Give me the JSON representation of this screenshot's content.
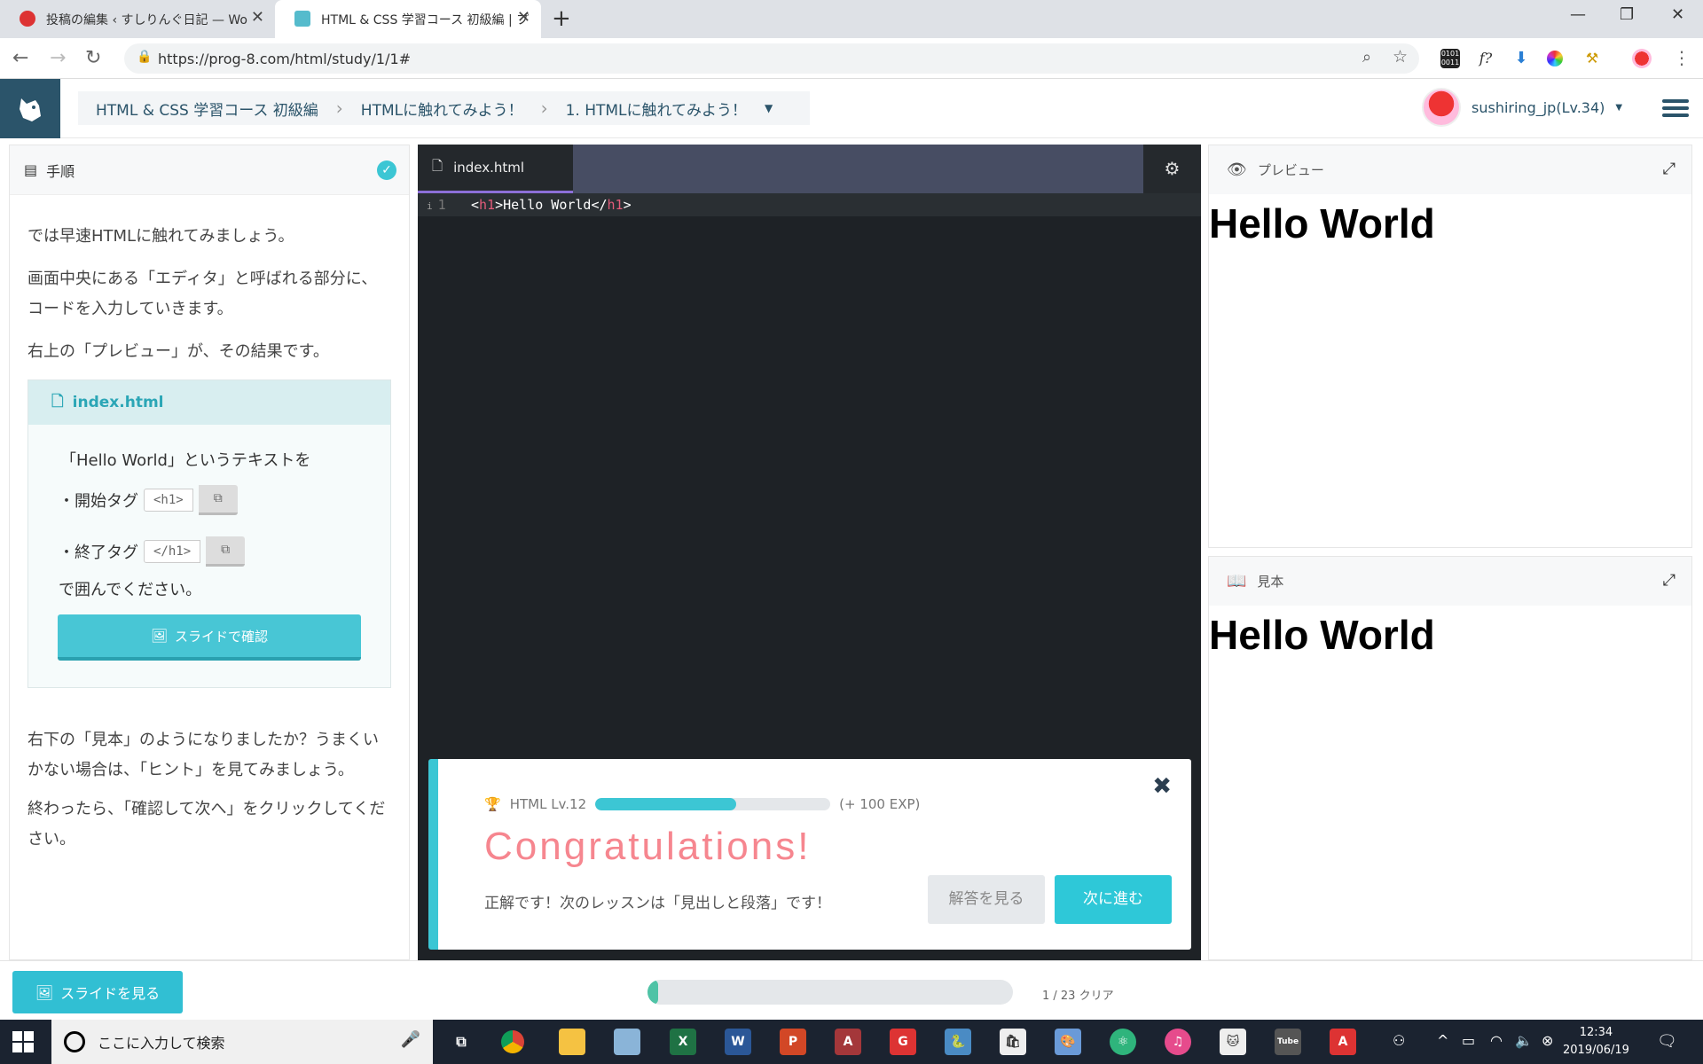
{
  "browser": {
    "tabs": [
      {
        "label": "投稿の編集 ‹ すしりんぐ日記 — Wo"
      },
      {
        "label": "HTML & CSS 学習コース 初級編 | プ"
      }
    ],
    "new_tab_glyph": "+",
    "url": "https://prog-8.com/html/study/1/1#",
    "window_controls": {
      "minimize": "—",
      "restore": "❐",
      "close": "✕"
    }
  },
  "app": {
    "breadcrumbs": [
      "HTML & CSS 学習コース 初級編",
      "HTMLに触れてみよう！",
      "1. HTMLに触れてみよう！"
    ],
    "username": "sushiring_jp(Lv.34)"
  },
  "instructions": {
    "header": "手順",
    "paragraphs": [
      "では早速HTMLに触れてみましょう。",
      "画面中央にある「エディタ」と呼ばれる部分に、コードを入力していきます。",
      "右上の「プレビュー」が、その結果です。"
    ],
    "box": {
      "filename": "index.html",
      "line1": "「Hello World」というテキストを",
      "start_label": "・開始タグ",
      "start_tag": "<h1>",
      "end_label": "・終了タグ",
      "end_tag": "</h1>",
      "line_end": "で囲んでください。",
      "slide_button": "スライドで確認"
    },
    "paragraphs2": [
      "右下の「見本」のようになりましたか？うまくいかない場合は、「ヒント」を見てみましょう。",
      "終わったら、「確認して次へ」をクリックしてください。"
    ]
  },
  "editor": {
    "tab": "index.html",
    "line_number": "1",
    "code": {
      "open_lt": "<",
      "open_tag": "h1",
      "open_gt": ">",
      "text": "Hello World",
      "close_lt": "</",
      "close_tag": "h1",
      "close_gt": ">"
    }
  },
  "congrats": {
    "level_label": "HTML Lv.12",
    "progress": 0.6,
    "exp": "(+ 100 EXP)",
    "title": "Congratulations!",
    "message": "正解です！次のレッスンは「見出しと段落」です！",
    "answer_button": "解答を見る",
    "next_button": "次に進む"
  },
  "preview": {
    "header": "プレビュー",
    "content": "Hello World"
  },
  "sample": {
    "header": "見本",
    "content": "Hello World"
  },
  "footer": {
    "slide_button": "スライドを見る",
    "progress": 0.03,
    "progress_text": "1 / 23 クリア"
  },
  "taskbar": {
    "search_placeholder": "ここに入力して検索",
    "time": "12:34",
    "date": "2019/06/19"
  },
  "colors": {
    "accent": "#3cc6d4",
    "brand": "#2b546a",
    "congrats_title": "#f6868f",
    "progress": "#4fc3a6"
  }
}
